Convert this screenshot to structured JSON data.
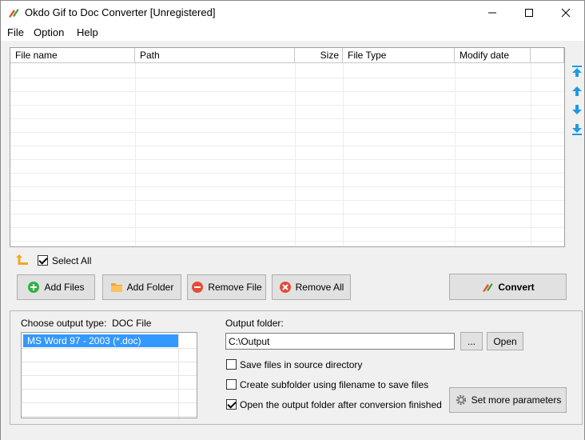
{
  "window": {
    "title": "Okdo Gif to Doc Converter [Unregistered]"
  },
  "menu": {
    "items": [
      "File",
      "Option",
      "Help"
    ]
  },
  "table": {
    "columns": [
      "File name",
      "Path",
      "Size",
      "File Type",
      "Modify date"
    ],
    "rows": []
  },
  "select_all": {
    "label": "Select All",
    "checked": true
  },
  "buttons": {
    "add_files": "Add Files",
    "add_folder": "Add Folder",
    "remove_file": "Remove File",
    "remove_all": "Remove All",
    "convert": "Convert",
    "browse": "...",
    "open": "Open",
    "set_more_parameters": "Set more parameters"
  },
  "output_type": {
    "label": "Choose output type:",
    "value": "DOC File",
    "options": [
      "MS Word 97 - 2003 (*.doc)"
    ],
    "selected": "MS Word 97 - 2003 (*.doc)"
  },
  "output_folder": {
    "label": "Output folder:",
    "value": "C:\\Output"
  },
  "options": {
    "save_in_source": {
      "label": "Save files in source directory",
      "checked": false
    },
    "create_subfolder": {
      "label": "Create subfolder using filename to save files",
      "checked": false
    },
    "open_after": {
      "label": "Open the output folder after conversion finished",
      "checked": true
    }
  },
  "colors": {
    "accent": "#3399ff",
    "arrow_blue": "#1e9be0",
    "add_green": "#2fb344",
    "remove_red": "#e44b3a",
    "folder_orange": "#f5a623"
  }
}
